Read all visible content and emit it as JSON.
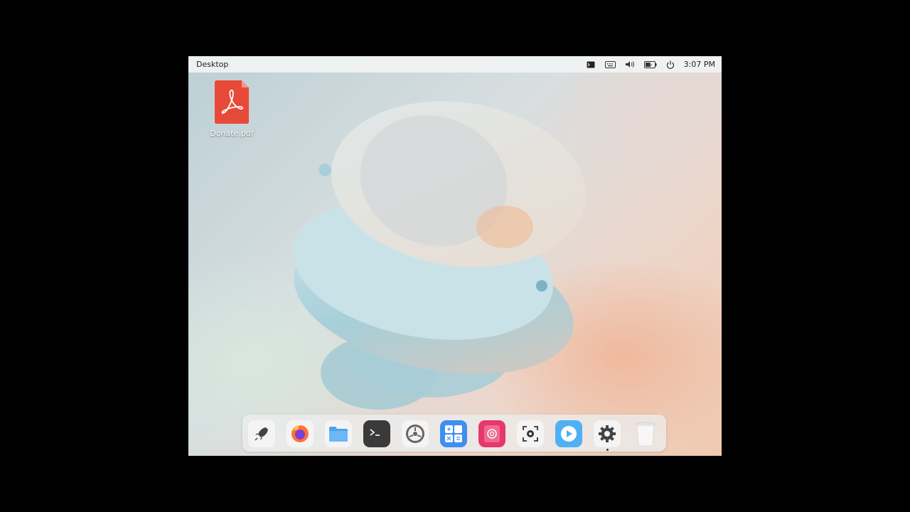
{
  "topbar": {
    "title": "Desktop",
    "clock": "3:07 PM",
    "tray_icons": [
      "terminal-icon",
      "keyboard-icon",
      "volume-icon",
      "battery-icon",
      "power-icon"
    ]
  },
  "desktop": {
    "icons": [
      {
        "label": "Donate.pdf",
        "icon": "pdf-file-icon"
      }
    ]
  },
  "dock": {
    "apps": [
      {
        "icon": "launcher-icon"
      },
      {
        "icon": "firefox-icon"
      },
      {
        "icon": "files-icon"
      },
      {
        "icon": "terminal-icon"
      },
      {
        "icon": "system-settings-icon"
      },
      {
        "icon": "calculator-icon"
      },
      {
        "icon": "debian-icon"
      },
      {
        "icon": "screenshot-icon"
      },
      {
        "icon": "media-player-icon"
      },
      {
        "icon": "settings-gear-icon",
        "running": true
      },
      {
        "icon": "trash-icon"
      }
    ]
  },
  "colors": {
    "pdf_red": "#e84a3a",
    "firefox_orange": "#ff7139",
    "files_blue": "#4aa3f0",
    "terminal_dark": "#3a3a3a",
    "calculator_blue": "#3d8ff0",
    "debian_pink": "#e6386a",
    "player_blue": "#4fb0f5"
  }
}
